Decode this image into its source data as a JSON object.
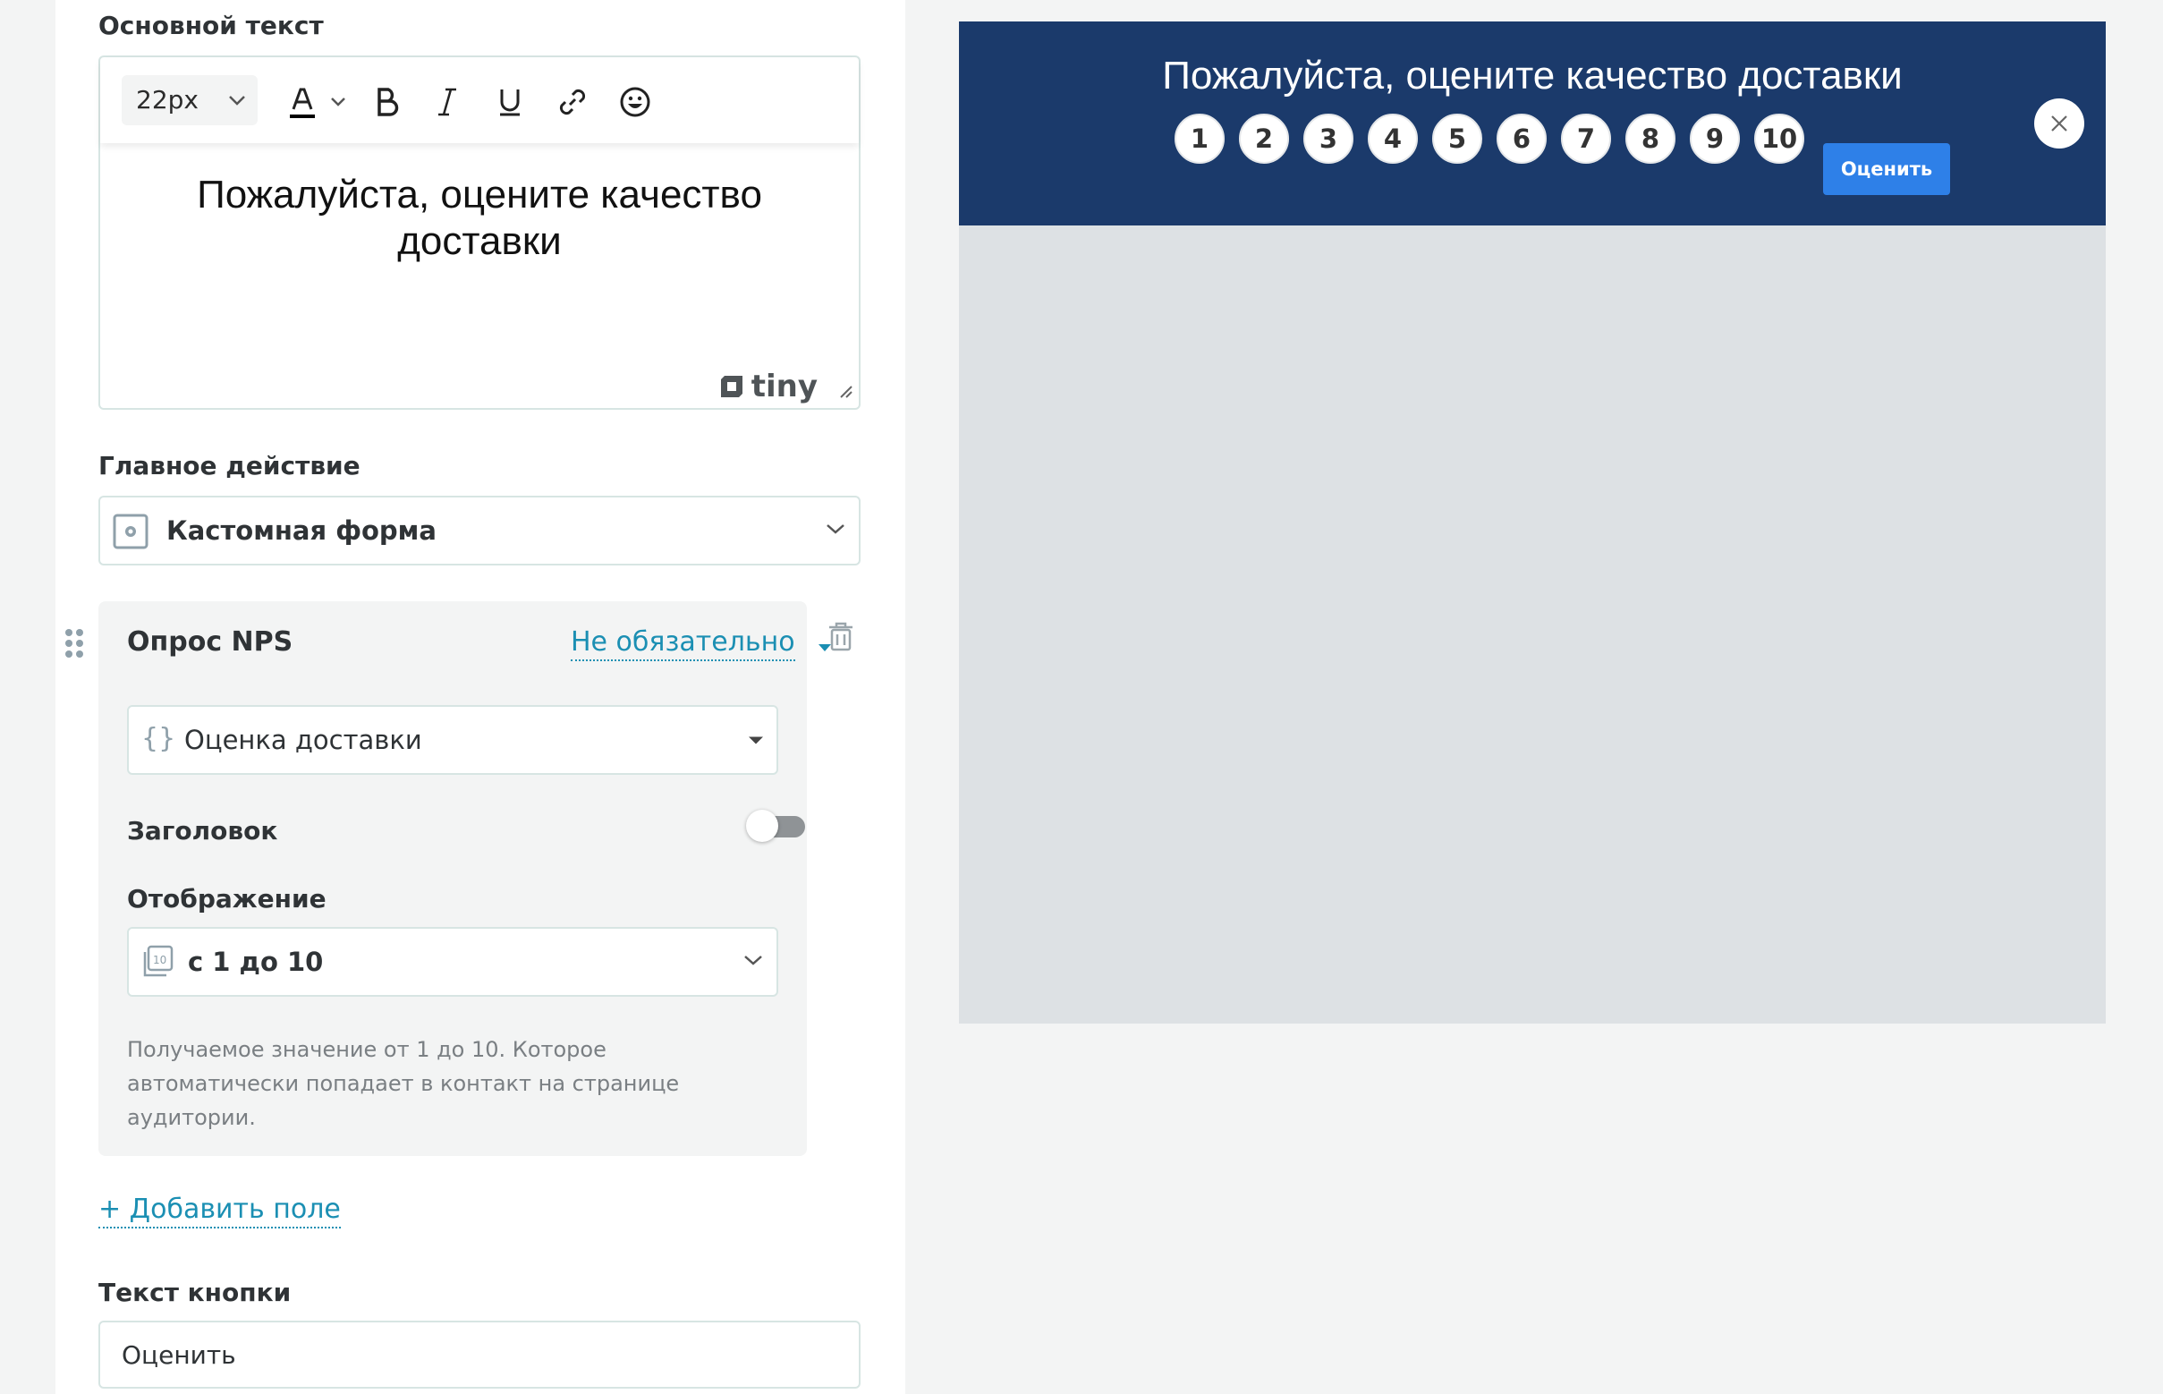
{
  "editor": {
    "section_label": "Основной текст",
    "font_size": "22px",
    "content": "Пожалуйста, оцените качество доставки",
    "brand": "tiny"
  },
  "main_action": {
    "label": "Главное действие",
    "value": "Кастомная форма"
  },
  "nps": {
    "title": "Опрос NPS",
    "required_state": "Не обязательно",
    "variable": "Оценка доставки",
    "header_label": "Заголовок",
    "header_enabled": false,
    "display_label": "Отображение",
    "display_value": "с 1 до 10",
    "hint": "Получаемое значение от 1 до 10. Которое автоматически попадает в контакт на странице аудитории."
  },
  "add_field": "+ Добавить поле",
  "button_text": {
    "label": "Текст кнопки",
    "value": "Оценить"
  },
  "preview": {
    "title": "Пожалуйста, оцените качество доставки",
    "scores": [
      "1",
      "2",
      "3",
      "4",
      "5",
      "6",
      "7",
      "8",
      "9",
      "10"
    ],
    "submit_label": "Оценить",
    "banner_color": "#1b3a6b",
    "submit_color": "#2e80e8"
  },
  "colors": {
    "accent": "#1b8fb3",
    "border": "#d7e5e3"
  }
}
